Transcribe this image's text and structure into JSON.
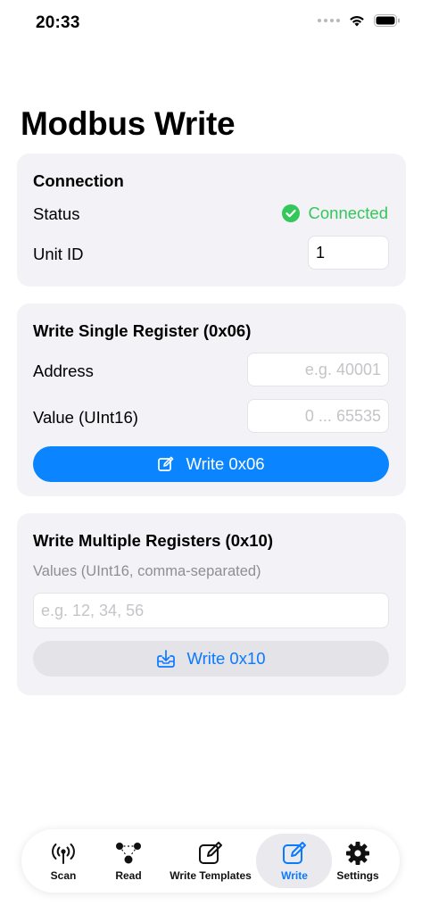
{
  "status_bar": {
    "time": "20:33"
  },
  "page": {
    "title": "Modbus Write"
  },
  "connection": {
    "title": "Connection",
    "status_label": "Status",
    "status_value": "Connected",
    "unit_id_label": "Unit ID",
    "unit_id_value": "1"
  },
  "single_register": {
    "title": "Write Single Register (0x06)",
    "address_label": "Address",
    "address_placeholder": "e.g. 40001",
    "value_label": "Value (UInt16)",
    "value_placeholder": "0 ... 65535",
    "button_label": "Write 0x06"
  },
  "multiple_registers": {
    "title": "Write Multiple Registers (0x10)",
    "values_hint": "Values (UInt16, comma-separated)",
    "values_placeholder": "e.g. 12, 34, 56",
    "button_label": "Write 0x10"
  },
  "tabbar": {
    "items": [
      {
        "label": "Scan",
        "icon": "antenna-icon"
      },
      {
        "label": "Read",
        "icon": "network-nodes-icon"
      },
      {
        "label": "Write Templates",
        "icon": "square-pencil-icon"
      },
      {
        "label": "Write",
        "icon": "square-pencil-icon",
        "active": true
      },
      {
        "label": "Settings",
        "icon": "gear-icon"
      }
    ]
  },
  "colors": {
    "accent": "#0a84ff",
    "connected_green": "#34c759",
    "card_background": "#f2f2f7",
    "placeholder": "#c4c4c9"
  }
}
